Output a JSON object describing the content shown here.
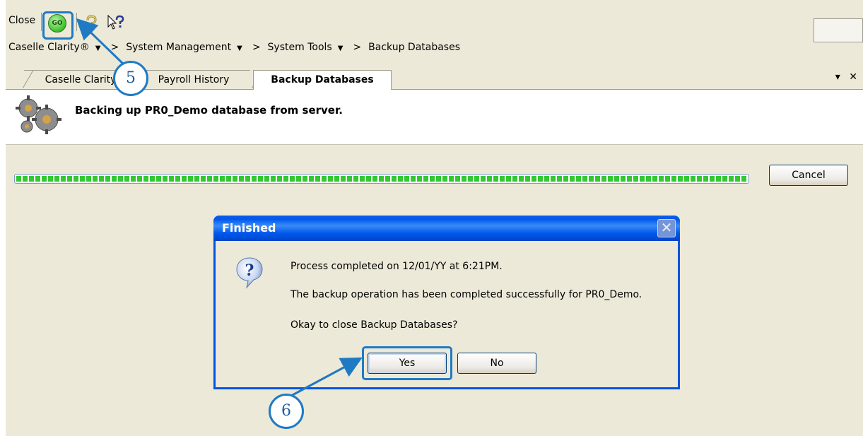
{
  "toolbar": {
    "close_label": "Close",
    "go_label": "GO",
    "icons": [
      "go-icon",
      "help-icon",
      "whats-this-icon"
    ]
  },
  "breadcrumb": {
    "items": [
      "Caselle Clarity®",
      "System Management",
      "System Tools",
      "Backup Databases"
    ],
    "separator": ">"
  },
  "tabs": [
    {
      "label": "Caselle Clarity",
      "active": false
    },
    {
      "label": "Payroll History",
      "active": false
    },
    {
      "label": "Backup Databases",
      "active": true
    }
  ],
  "tab_controls": {
    "menu": "▾",
    "close": "✕"
  },
  "header": {
    "status": "Backing up PR0_Demo database from server."
  },
  "progress": {
    "fraction": 1.0,
    "cancel_label": "Cancel"
  },
  "dialog": {
    "title": "Finished",
    "close_glyph": "✕",
    "lines": [
      "Process completed on 12/01/YY at 6:21PM.",
      "The backup operation has been completed successfully for PR0_Demo.",
      "Okay to close Backup Databases?"
    ],
    "yes_label": "Yes",
    "no_label": "No"
  },
  "callouts": {
    "step5": "5",
    "step6": "6"
  },
  "colors": {
    "window_bg": "#ece9d8",
    "title_blue": "#0058ee",
    "highlight": "#1f7ac4",
    "progress_green": "#32c832"
  }
}
